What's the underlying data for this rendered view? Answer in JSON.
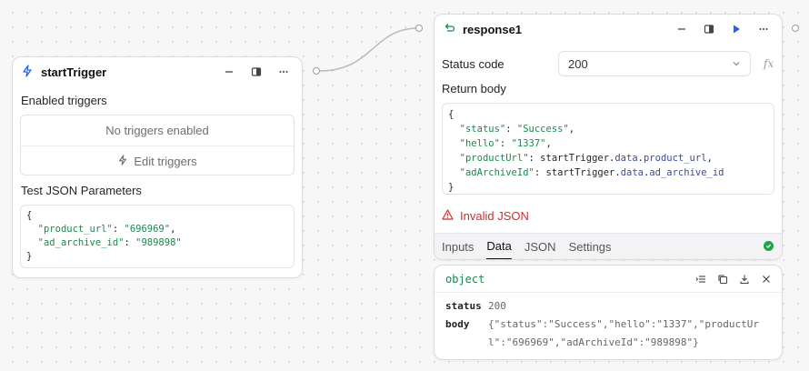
{
  "start_node": {
    "title": "startTrigger",
    "enabled_triggers_label": "Enabled triggers",
    "no_triggers_text": "No triggers enabled",
    "edit_triggers_label": "Edit triggers",
    "test_json_label": "Test JSON Parameters",
    "test_json_lines": [
      {
        "text": "{"
      },
      {
        "key": "\"product_url\"",
        "sep": ": ",
        "val": "\"696969\"",
        "end": ","
      },
      {
        "key": "\"ad_archive_id\"",
        "sep": ": ",
        "val": "\"989898\"",
        "end": ""
      },
      {
        "text": "}"
      }
    ]
  },
  "response_node": {
    "title": "response1",
    "status_code_label": "Status code",
    "status_code_value": "200",
    "fx_label": "fx",
    "return_body_label": "Return body",
    "return_body_lines": [
      {
        "text": "{"
      },
      {
        "key": "\"status\"",
        "sep": ": ",
        "str": "\"Success\"",
        "end": ","
      },
      {
        "key": "\"hello\"",
        "sep": ": ",
        "str": "\"1337\"",
        "end": ","
      },
      {
        "key": "\"productUrl\"",
        "sep": ": ",
        "expr": "startTrigger.",
        "prop": "data",
        "expr2": ".",
        "prop2": "product_url",
        "end": ","
      },
      {
        "key": "\"adArchiveId\"",
        "sep": ": ",
        "expr": "startTrigger.",
        "prop": "data",
        "expr2": ".",
        "prop2": "ad_archive_id",
        "end": ""
      },
      {
        "text": "}"
      }
    ],
    "error_text": "Invalid JSON",
    "tabs": [
      "Inputs",
      "Data",
      "JSON",
      "Settings"
    ],
    "active_tab": "Data"
  },
  "output_panel": {
    "type_label": "object",
    "rows": [
      {
        "key": "status",
        "value": "200"
      },
      {
        "key": "body",
        "value": "{\"status\":\"Success\",\"hello\":\"1337\",\"productUrl\":\"696969\",\"adArchiveId\":\"989898\"}"
      }
    ]
  },
  "colors": {
    "accent_blue": "#2563eb",
    "green": "#1ea446",
    "error_red": "#d12d2d"
  }
}
